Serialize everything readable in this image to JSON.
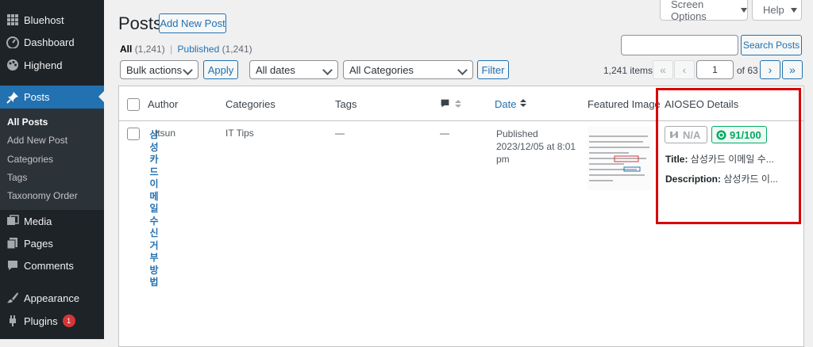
{
  "sidebar": {
    "items": [
      {
        "label": "Bluehost",
        "icon": "grid-icon"
      },
      {
        "label": "Dashboard",
        "icon": "dashboard-icon"
      },
      {
        "label": "Highend",
        "icon": "palette-icon"
      },
      {
        "label": "Posts",
        "icon": "pin-icon"
      },
      {
        "label": "Media",
        "icon": "media-icon"
      },
      {
        "label": "Pages",
        "icon": "pages-icon"
      },
      {
        "label": "Comments",
        "icon": "comment-icon"
      },
      {
        "label": "Appearance",
        "icon": "brush-icon"
      },
      {
        "label": "Plugins",
        "icon": "plug-icon",
        "badge": "1"
      }
    ],
    "submenu": [
      "All Posts",
      "Add New Post",
      "Categories",
      "Tags",
      "Taxonomy Order"
    ]
  },
  "header": {
    "title": "Posts",
    "add_new": "Add New Post",
    "screen_options": "Screen Options",
    "help": "Help"
  },
  "views": {
    "all_label": "All",
    "all_count": "(1,241)",
    "separator": "|",
    "published_label": "Published",
    "published_count": "(1,241)"
  },
  "search": {
    "button": "Search Posts",
    "value": ""
  },
  "filters": {
    "bulk_actions": "Bulk actions",
    "apply": "Apply",
    "dates": "All dates",
    "categories": "All Categories",
    "filter": "Filter"
  },
  "pagination": {
    "items": "1,241 items",
    "first": "«",
    "prev": "‹",
    "current_page": "1",
    "of": "of 63",
    "next": "›",
    "last": "»"
  },
  "table": {
    "columns": {
      "author": "Author",
      "categories": "Categories",
      "tags": "Tags",
      "date": "Date",
      "featured_image": "Featured Image",
      "aioseo": "AIOSEO Details"
    },
    "row": {
      "title_chars": [
        "삼",
        "성",
        "카",
        "드",
        "이",
        "메",
        "일",
        "수",
        "신",
        "거",
        "부",
        "방",
        "법"
      ],
      "author": "ttsun",
      "category": "IT Tips",
      "tags": "—",
      "comments": "—",
      "date_status": "Published",
      "date_value": "2023/12/05 at 8:01",
      "date_suffix": "pm",
      "na_label": "N/A",
      "score": "91/100",
      "seo_title_label": "Title:",
      "seo_title": "삼성카드 이메일 수...",
      "seo_desc_label": "Description:",
      "seo_desc": "삼성카드 이...",
      "thumb_lines": [
        "sungcard.com. 뒤에 -...",
        "...",
        "..."
      ]
    }
  },
  "colors": {
    "accent": "#2271b1",
    "sidebar": "#1d2327",
    "highlight": "#d90000",
    "score": "#00aa63"
  }
}
